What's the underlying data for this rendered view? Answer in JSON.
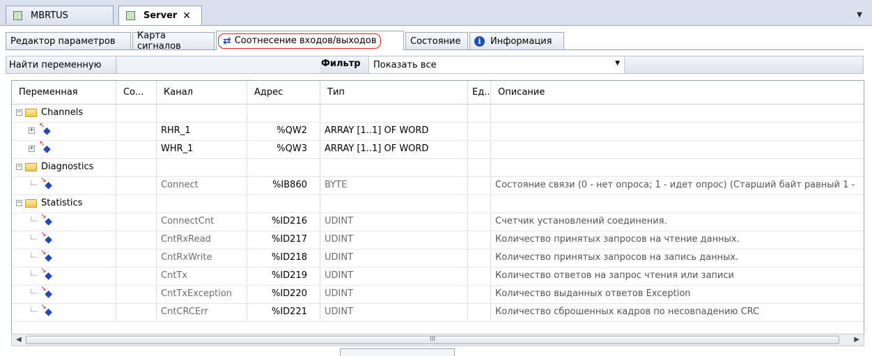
{
  "doc_tabs": [
    {
      "label": "MBRTUS",
      "active": false
    },
    {
      "label": "Server",
      "active": true,
      "close": "✕"
    }
  ],
  "editor_tabs": [
    {
      "label": "Редактор параметров"
    },
    {
      "label": "Карта сигналов"
    },
    {
      "label": "Соотнесение входов/выходов",
      "active": true
    },
    {
      "label": "Состояние"
    },
    {
      "label": "Информация"
    }
  ],
  "filter_bar": {
    "find_label": "Найти переменную",
    "find_value": "",
    "filter_label": "Фильтр",
    "filter_value": "Показать все"
  },
  "grid": {
    "columns": [
      "Переменная",
      "Со...",
      "Канал",
      "Адрес",
      "Тип",
      "Ед...",
      "Описание"
    ],
    "rows": [
      {
        "kind": "folder",
        "variable": "Channels",
        "channel": "",
        "address": "",
        "type": "",
        "description": ""
      },
      {
        "kind": "var-out",
        "variable": "",
        "channel": "RHR_1",
        "address": "%QW2",
        "type": "ARRAY [1..1] OF WORD",
        "description": ""
      },
      {
        "kind": "var-out",
        "variable": "",
        "channel": "WHR_1",
        "address": "%QW3",
        "type": "ARRAY [1..1] OF WORD",
        "description": ""
      },
      {
        "kind": "folder",
        "variable": "Diagnostics",
        "channel": "",
        "address": "",
        "type": "",
        "description": ""
      },
      {
        "kind": "var-in",
        "variable": "",
        "channel": "Connect",
        "address": "%IB860",
        "type": "BYTE",
        "description": "Состояние связи (0 - нет опроса; 1 - идет опрос) (Старший байт равный 1 -"
      },
      {
        "kind": "folder",
        "variable": "Statistics",
        "channel": "",
        "address": "",
        "type": "",
        "description": ""
      },
      {
        "kind": "var-in",
        "variable": "",
        "channel": "ConnectCnt",
        "address": "%ID216",
        "type": "UDINT",
        "description": "Счетчик установлений соединения."
      },
      {
        "kind": "var-in",
        "variable": "",
        "channel": "CntRxRead",
        "address": "%ID217",
        "type": "UDINT",
        "description": "Количество принятых запросов на чтение данных."
      },
      {
        "kind": "var-in",
        "variable": "",
        "channel": "CntRxWrite",
        "address": "%ID218",
        "type": "UDINT",
        "description": "Количество принятых запросов на запись данных."
      },
      {
        "kind": "var-in",
        "variable": "",
        "channel": "CntTx",
        "address": "%ID219",
        "type": "UDINT",
        "description": "Количество ответов на запрос чтения или записи"
      },
      {
        "kind": "var-in",
        "variable": "",
        "channel": "CntTxException",
        "address": "%ID220",
        "type": "UDINT",
        "description": "Количество выданных ответов Exception"
      },
      {
        "kind": "var-in",
        "variable": "",
        "channel": "CntCRCErr",
        "address": "%ID221",
        "type": "UDINT",
        "description": "Количество сброшенных кадров по несовпадению CRC"
      }
    ]
  },
  "scrollbar": {
    "thumb_grip": "III"
  },
  "icons": {
    "doc_tab_icon": "device-icon",
    "swap_icon": "swap-arrows-icon",
    "info_icon": "info-icon",
    "folder_icon": "folder-icon",
    "var_icon": "variable-mapping-icon"
  },
  "colors": {
    "highlight_circle": "#e02020",
    "accent_blue": "#1d4fb8"
  }
}
